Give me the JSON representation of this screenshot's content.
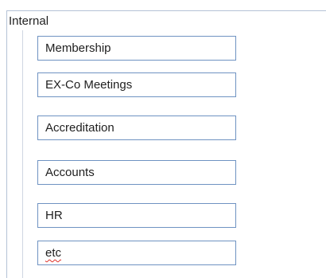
{
  "group": {
    "title": "Internal"
  },
  "fields": [
    {
      "label": "Membership"
    },
    {
      "label": "EX-Co Meetings"
    },
    {
      "label": "Accreditation"
    },
    {
      "label": "Accounts"
    },
    {
      "label": "HR"
    },
    {
      "label": "etc",
      "spellcheck_flag": true
    }
  ],
  "colors": {
    "frame_border": "#b4c2d6",
    "field_border": "#6f93c2",
    "spellcheck_underline": "#e0312b"
  }
}
